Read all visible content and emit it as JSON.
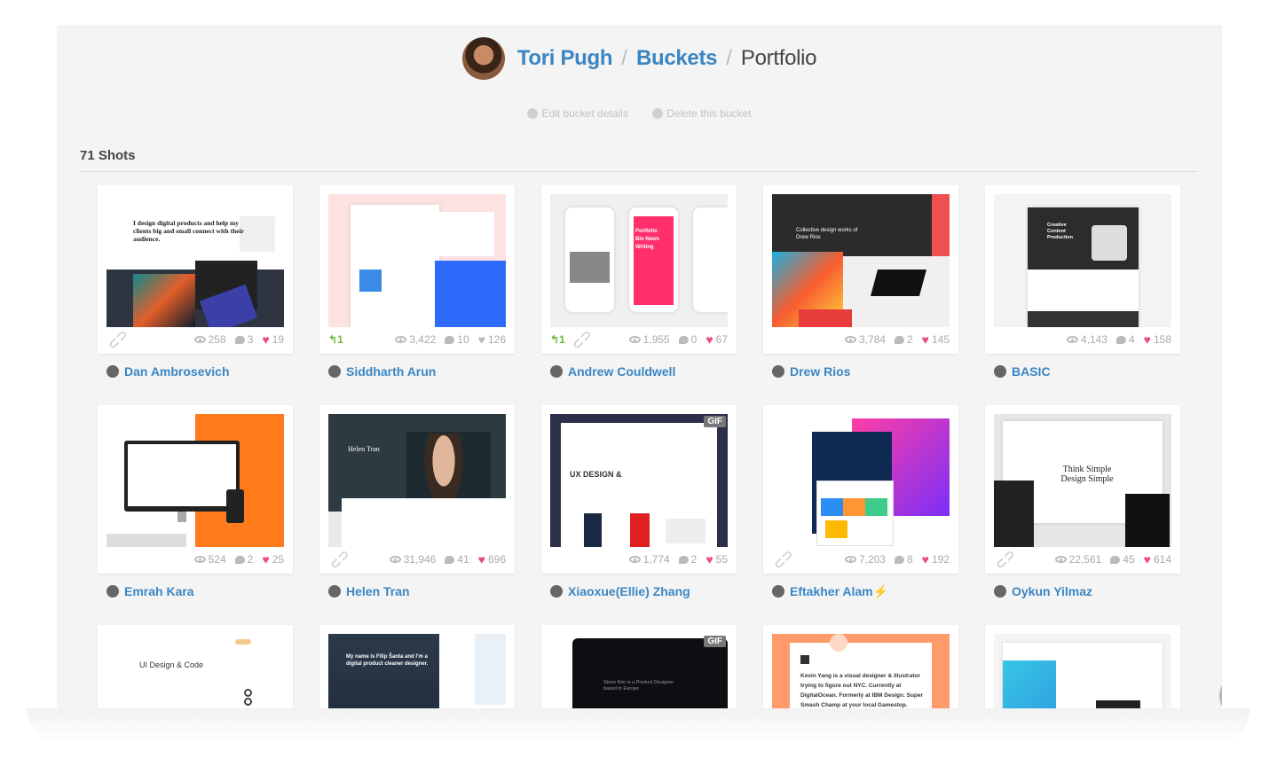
{
  "breadcrumb": {
    "user": "Tori Pugh",
    "sep": "/",
    "section": "Buckets",
    "current": "Portfolio"
  },
  "actions": {
    "edit": "Edit bucket details",
    "delete": "Delete this bucket"
  },
  "shots_count": "71 Shots",
  "colors": {
    "link": "#3a86c4",
    "heart": "#ea4c89",
    "rebound": "#6fb83b",
    "page_bg": "#f4f4f4"
  },
  "shots": [
    {
      "player": "Dan Ambrosevich",
      "views": "258",
      "comments": "3",
      "likes": "19",
      "liked": true,
      "rebounds": "",
      "attachment": true,
      "gif": false,
      "thumb": "t1"
    },
    {
      "player": "Siddharth Arun",
      "views": "3,422",
      "comments": "10",
      "likes": "126",
      "liked": false,
      "rebounds": "1",
      "attachment": false,
      "gif": false,
      "thumb": "t2"
    },
    {
      "player": "Andrew Couldwell",
      "views": "1,955",
      "comments": "0",
      "likes": "67",
      "liked": true,
      "rebounds": "1",
      "attachment": true,
      "gif": false,
      "thumb": "t3"
    },
    {
      "player": "Drew Rios",
      "views": "3,784",
      "comments": "2",
      "likes": "145",
      "liked": true,
      "rebounds": "",
      "attachment": false,
      "gif": false,
      "thumb": "t4"
    },
    {
      "player": "BASIC",
      "views": "4,143",
      "comments": "4",
      "likes": "158",
      "liked": true,
      "rebounds": "",
      "attachment": false,
      "gif": false,
      "thumb": "t5"
    },
    {
      "player": "Emrah Kara",
      "views": "524",
      "comments": "2",
      "likes": "25",
      "liked": true,
      "rebounds": "",
      "attachment": false,
      "gif": false,
      "thumb": "t6"
    },
    {
      "player": "Helen Tran",
      "views": "31,946",
      "comments": "41",
      "likes": "696",
      "liked": true,
      "rebounds": "",
      "attachment": true,
      "gif": false,
      "thumb": "t7"
    },
    {
      "player": "Xiaoxue(Ellie) Zhang",
      "views": "1,774",
      "comments": "2",
      "likes": "55",
      "liked": true,
      "rebounds": "",
      "attachment": false,
      "gif": true,
      "thumb": "t8"
    },
    {
      "player": "Eftakher Alam⚡",
      "views": "7,203",
      "comments": "8",
      "likes": "192",
      "liked": true,
      "rebounds": "",
      "attachment": true,
      "gif": false,
      "thumb": "t9"
    },
    {
      "player": "Oykun Yilmaz",
      "views": "22,561",
      "comments": "45",
      "likes": "614",
      "liked": true,
      "rebounds": "",
      "attachment": true,
      "gif": false,
      "thumb": "t10"
    },
    {
      "player": "",
      "views": "",
      "comments": "",
      "likes": "",
      "liked": false,
      "rebounds": "",
      "attachment": false,
      "gif": false,
      "thumb": "t11"
    },
    {
      "player": "",
      "views": "",
      "comments": "",
      "likes": "",
      "liked": false,
      "rebounds": "",
      "attachment": false,
      "gif": false,
      "thumb": "t12"
    },
    {
      "player": "",
      "views": "",
      "comments": "",
      "likes": "",
      "liked": false,
      "rebounds": "",
      "attachment": false,
      "gif": true,
      "thumb": "t13"
    },
    {
      "player": "",
      "views": "",
      "comments": "",
      "likes": "",
      "liked": false,
      "rebounds": "",
      "attachment": false,
      "gif": false,
      "thumb": "t14"
    },
    {
      "player": "",
      "views": "",
      "comments": "",
      "likes": "",
      "liked": false,
      "rebounds": "",
      "attachment": false,
      "gif": false,
      "thumb": "t15"
    }
  ],
  "thumb_text": {
    "t1": "I design digital products and help my clients big and small connect with their audience.",
    "t3": "Portfolio Bio News Writing",
    "t4": "Collective design works of Drew Rios",
    "t5": "Creative Content Production",
    "t7": "Helen Tran",
    "t8": "UX DESIGN &",
    "t10": "Think Simple Design Simple",
    "t11": "UI Design & Code",
    "t12": "My name is Filip Šanta and I'm a digital product cleaner designer.",
    "t13": "Steve Kim is a Product Designer based in Europe",
    "t14": "Kevin Yang is a visual designer & illustrator trying to figure out NYC. Currently at DigitalOcean. Formerly at IBM Design. Super Smash Champ at your local Gamestop.",
    "gif_label": "GIF"
  },
  "back_to_top": "back-to-top"
}
